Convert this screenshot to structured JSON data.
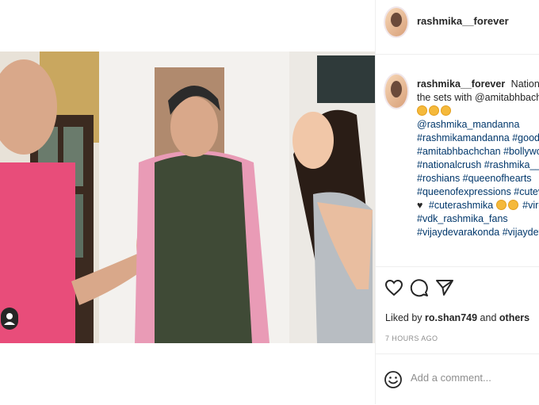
{
  "header": {
    "username": "rashmika__forever"
  },
  "caption": {
    "username": "rashmika__forever",
    "lines": [
      "National crush",
      "the sets with @amitabhbachchan",
      "@rashmika_mandanna",
      "#rashmikamandanna #goodbye",
      "#amitabhbachchan #bollywood",
      "#nationalcrush #rashmika__forever",
      "#roshians #queenofhearts",
      "#queenofexpressions #cutevijra",
      "#cuterashmika",
      "#viroshfans",
      "#vdk_rashmika_fans",
      "#vijaydevarakonda #vijaydevarakonda"
    ]
  },
  "post": {
    "likes_prefix": "Liked by",
    "likes_user": "ro.shan749",
    "likes_and": "and",
    "likes_others": "others",
    "time": "7 HOURS AGO"
  },
  "comment": {
    "placeholder": "Add a comment..."
  },
  "icons": {
    "like": "heart-icon",
    "comment": "comment-icon",
    "share": "share-icon",
    "emoji": "emoji-icon",
    "user_tag": "user-tag-icon"
  },
  "colors": {
    "hashtag": "#00376b",
    "text": "#262626",
    "muted": "#8e8e8e"
  }
}
